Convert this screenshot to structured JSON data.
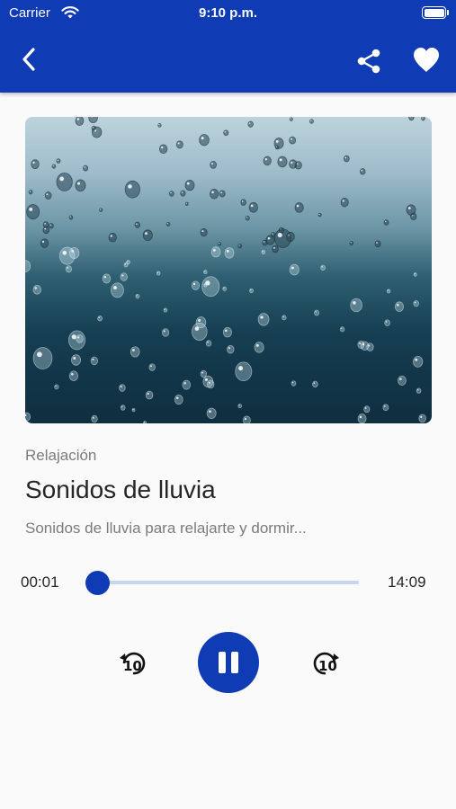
{
  "status_bar": {
    "carrier": "Carrier",
    "time": "9:10 p.m."
  },
  "header": {
    "back_icon": "chevron-left-icon",
    "share_icon": "share-icon",
    "favorite_icon": "heart-icon"
  },
  "track": {
    "category": "Relajación",
    "title": "Sonidos de lluvia",
    "description": "Sonidos de lluvia para relajarte y dormir..."
  },
  "player": {
    "current_time": "00:01",
    "total_time": "14:09",
    "progress": 0.001,
    "rewind_label": "10",
    "forward_label": "10",
    "state": "playing"
  },
  "colors": {
    "primary": "#0f3bb5",
    "track": "#c9d4ef",
    "background": "#fafafa"
  }
}
